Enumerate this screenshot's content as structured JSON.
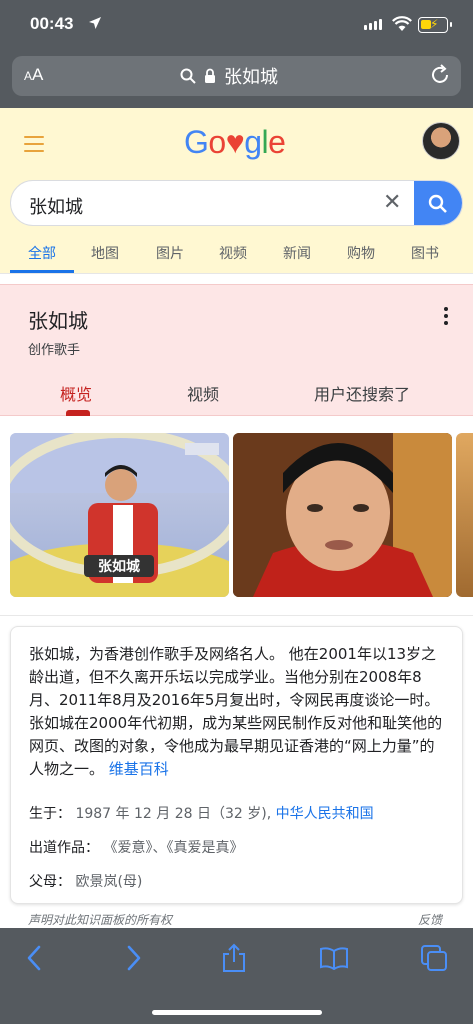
{
  "status": {
    "time": "00:43"
  },
  "urlbar": {
    "aa": "AA",
    "url": "张如城"
  },
  "google": {
    "logo_letters": [
      {
        "ch": "G",
        "color": "#4285f4"
      },
      {
        "ch": "o",
        "color": "#ea4335"
      },
      {
        "ch": "♥",
        "color": "#ea4335"
      },
      {
        "ch": "g",
        "color": "#4285f4"
      },
      {
        "ch": "l",
        "color": "#34a853"
      },
      {
        "ch": "e",
        "color": "#ea4335"
      }
    ],
    "query": "张如城"
  },
  "tabs": [
    "全部",
    "地图",
    "图片",
    "视频",
    "新闻",
    "购物",
    "图书"
  ],
  "panel": {
    "title": "张如城",
    "subtitle": "创作歌手",
    "tabs": [
      "概览",
      "视频",
      "用户还搜索了"
    ],
    "image_captions": {
      "img1_overlay": "张如城"
    },
    "description": "张如城，为香港创作歌手及网络名人。 他在2001年以13岁之龄出道，但不久离开乐坛以完成学业。当他分别在2008年8月、2011年8月及2016年5月复出时，令网民再度谈论一时。 张如城在2000年代初期，成为某些网民制作反对他和耻笑他的网页、改图的对象，令他成为最早期见证香港的“网上力量”的人物之一。",
    "source_link": "维基百科",
    "facts": {
      "born_label": "生于：",
      "born_value": "1987 年 12 月 28 日（32 岁),",
      "born_place": "中华人民共和国",
      "works_label": "出道作品：",
      "works_value": "《爱意》、《真爱是真》",
      "parent_label": "父母：",
      "parent_value": "欧景岚(母)"
    },
    "claim": "声明对此知识面板的所有权",
    "feedback": "反馈"
  },
  "colors": {
    "chrome": "#555a5f",
    "google_bg": "#fff8d2",
    "panel_bg": "#fde6e6",
    "accent_red": "#c5221f",
    "link_blue": "#1a73e8",
    "ios_blue": "#4a8ef6"
  },
  "icons": {
    "location": "location-arrow-icon",
    "search": "search-icon",
    "lock": "lock-icon",
    "reload": "reload-icon",
    "back": "chevron-left-icon",
    "forward": "chevron-right-icon",
    "share": "share-icon",
    "bookmarks": "book-icon",
    "tabs": "tabs-icon"
  }
}
